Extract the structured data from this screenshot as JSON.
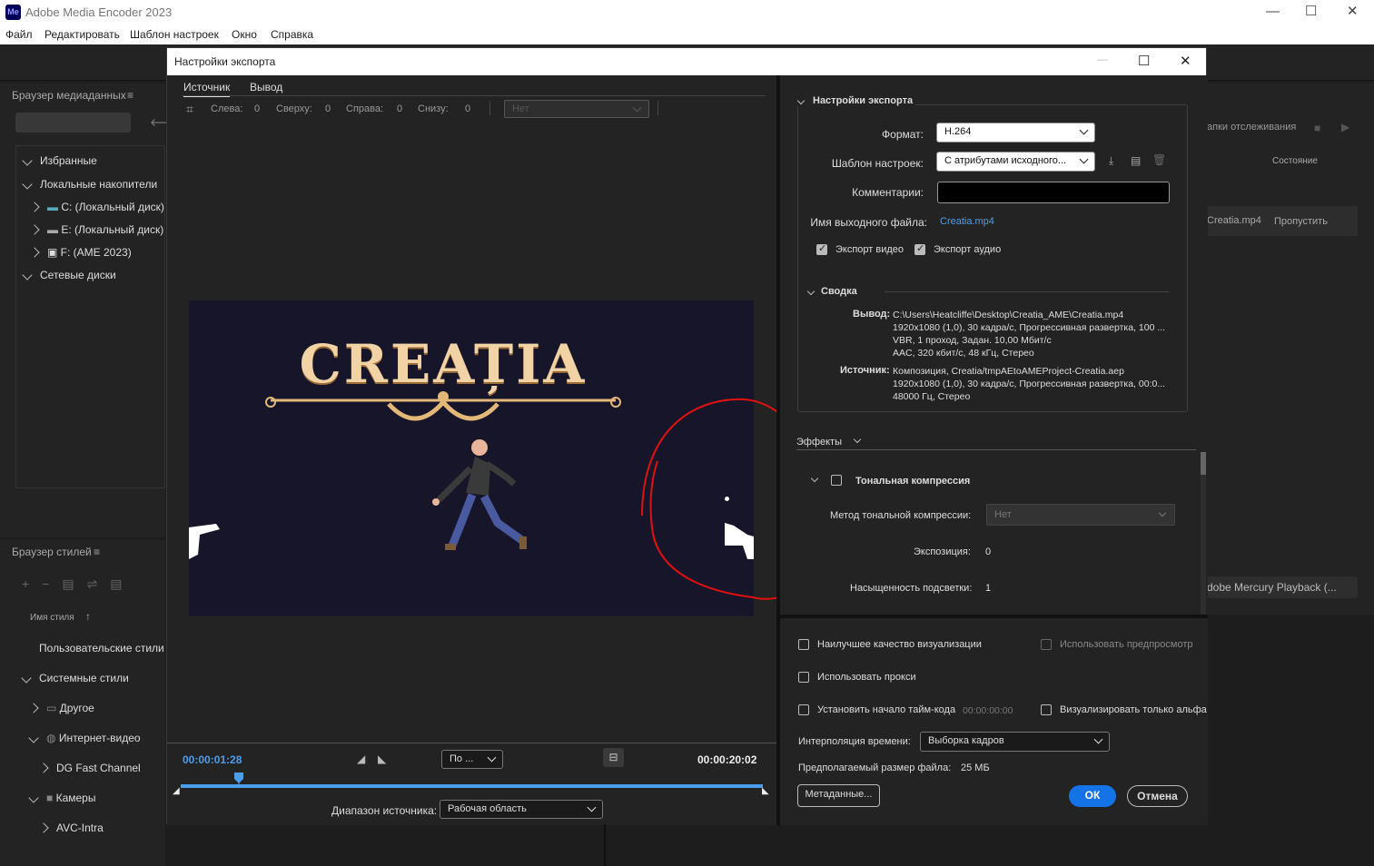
{
  "app": {
    "title": "Adobe Media Encoder 2023",
    "logo": "Me"
  },
  "menu": [
    "Файл",
    "Редактировать",
    "Шаблон настроек",
    "Окно",
    "Справка"
  ],
  "media_browser": {
    "title": "Браузер медиаданных",
    "tree": [
      {
        "label": "Избранные"
      },
      {
        "label": "Локальные накопители"
      },
      {
        "label": "C: (Локальный диск)"
      },
      {
        "label": "E: (Локальный диск)"
      },
      {
        "label": "F: (AME 2023)"
      },
      {
        "label": "Сетевые диски"
      }
    ]
  },
  "style_browser": {
    "title": "Браузер стилей",
    "column": "Имя стиля",
    "items": [
      "Пользовательские стили и",
      "Системные стили",
      "Другое",
      "Интернет-видео",
      "DG Fast Channel",
      "Камеры",
      "AVC-Intra"
    ]
  },
  "right_bg": {
    "watch": "апки отслеживания",
    "status_header": "Состояние",
    "file": "Creatia.mp4",
    "status": "Пропустить",
    "renderer": "dobe Mercury Playback (..."
  },
  "dialog": {
    "title": "Настройки экспорта",
    "tabs": [
      "Источник",
      "Вывод"
    ],
    "crop": {
      "left_label": "Слева:",
      "left": "0",
      "top_label": "Сверху:",
      "top": "0",
      "right_label": "Справа:",
      "right": "0",
      "bottom_label": "Снизу:",
      "bottom": "0",
      "preset": "Нет"
    },
    "video_title": "CREAȚIA",
    "timeline": {
      "current": "00:00:01:28",
      "end": "00:00:20:02",
      "fit": "По ...",
      "range_label": "Диапазон источника:",
      "range_value": "Рабочая область",
      "playhead_fraction": 0.1
    }
  },
  "export": {
    "section": "Настройки экспорта",
    "format_label": "Формат:",
    "format": "H.264",
    "preset_label": "Шаблон настроек:",
    "preset": "С атрибутами исходного...",
    "comments_label": "Комментарии:",
    "comments": "",
    "output_label": "Имя выходного файла:",
    "output": "Creatia.mp4",
    "export_video": "Экспорт видео",
    "export_audio": "Экспорт аудио",
    "summary": "Сводка",
    "out_label": "Вывод:",
    "out_lines": [
      "C:\\Users\\Heatcliffe\\Desktop\\Creatia_AME\\Creatia.mp4",
      "1920x1080 (1,0), 30 кадра/с, Прогрессивная развертка, 100 ...",
      "VBR, 1 проход, Задан. 10,00 Мбит/с",
      "AAC, 320 кбит/с, 48 кГц, Стерео"
    ],
    "src_label": "Источник:",
    "src_lines": [
      "Композиция, Creatia/tmpAEtoAMEProject-Creatia.aep",
      "1920x1080 (1,0), 30 кадра/с, Прогрессивная развертка, 00:0...",
      "48000 Гц, Стерео"
    ]
  },
  "effects": {
    "tab": "Эффекты",
    "tone": "Тональная компрессия",
    "method_label": "Метод тональной компрессии:",
    "method": "Нет",
    "exposure_label": "Экспозиция:",
    "exposure": "0",
    "highlight_label": "Насыщенность подсветки:",
    "highlight": "1"
  },
  "bottom": {
    "best_quality": "Наилучшее качество визуализации",
    "use_previews": "Использовать предпросмотр",
    "use_proxy": "Использовать прокси",
    "timecode": "Установить начало тайм-кода",
    "timecode_value": "00:00:00:00",
    "alpha": "Визуализировать только альфа",
    "interp_label": "Интерполяция времени:",
    "interp": "Выборка кадров",
    "size_label": "Предполагаемый размер файла:",
    "size": "25 МБ",
    "metadata": "Метаданные...",
    "ok": "ОК",
    "cancel": "Отмена"
  },
  "colors": {
    "accent": "#1473e6",
    "annotation": "#e01010",
    "link": "#4a9eed"
  }
}
